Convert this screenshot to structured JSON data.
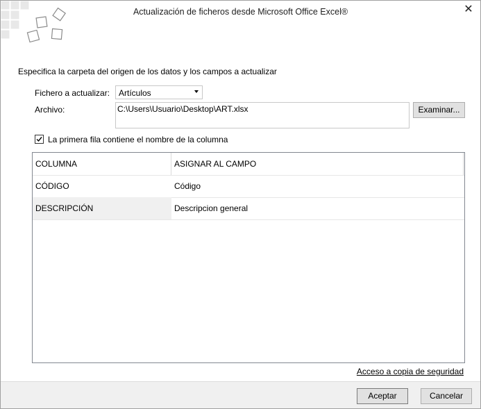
{
  "window": {
    "title": "Actualización de ficheros desde Microsoft Office Excel®"
  },
  "instruction": "Especifica la carpeta del origen de los datos y los campos a actualizar",
  "form": {
    "file_to_update_label": "Fichero a actualizar:",
    "file_to_update_value": "Artículos",
    "file_label": "Archivo:",
    "file_path": "C:\\Users\\Usuario\\Desktop\\ART.xlsx",
    "browse_label": "Examinar..."
  },
  "checkbox": {
    "label": "La primera fila contiene el nombre de la columna",
    "checked": true
  },
  "grid": {
    "headers": [
      "COLUMNA",
      "ASIGNAR AL CAMPO"
    ],
    "rows": [
      [
        "CÓDIGO",
        "Código"
      ],
      [
        "DESCRIPCIÓN",
        "Descripcion general"
      ]
    ]
  },
  "backup_link": "Acceso a copia de seguridad",
  "buttons": {
    "accept": "Aceptar",
    "cancel": "Cancelar"
  }
}
